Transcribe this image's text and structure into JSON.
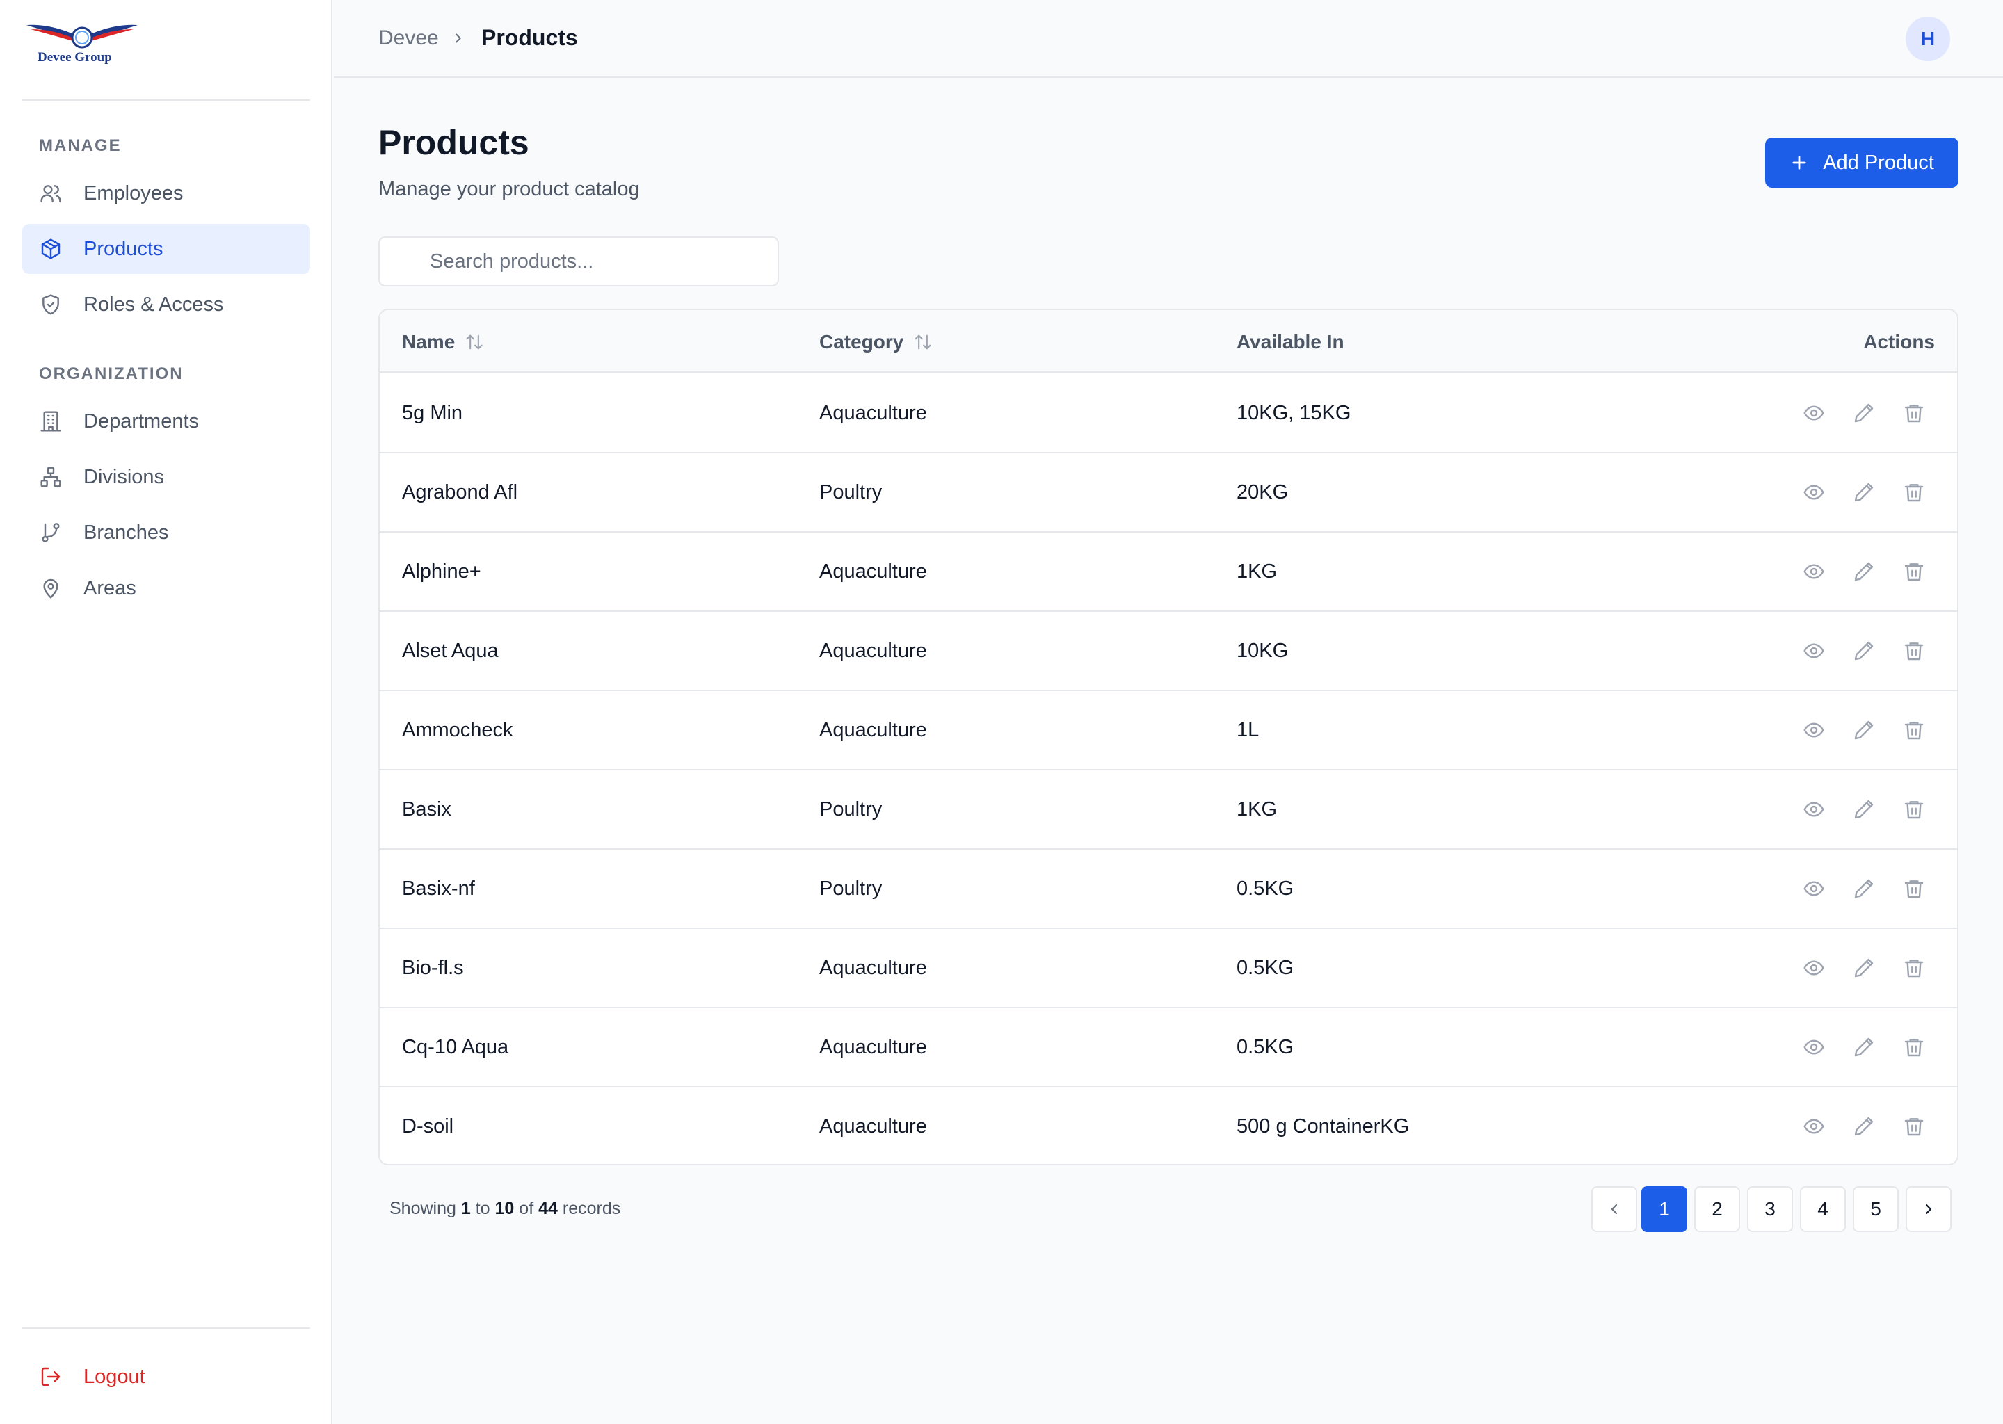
{
  "brand": {
    "logo_text": "Devee Group",
    "accent": "#1d5ee8"
  },
  "sidebar": {
    "sections": [
      {
        "label": "MANAGE",
        "items": [
          {
            "label": "Employees",
            "icon": "users-icon"
          },
          {
            "label": "Products",
            "icon": "box-icon",
            "active": true
          },
          {
            "label": "Roles & Access",
            "icon": "shield-icon"
          }
        ]
      },
      {
        "label": "ORGANIZATION",
        "items": [
          {
            "label": "Departments",
            "icon": "building-icon"
          },
          {
            "label": "Divisions",
            "icon": "network-icon"
          },
          {
            "label": "Branches",
            "icon": "git-branch-icon"
          },
          {
            "label": "Areas",
            "icon": "map-pin-icon"
          }
        ]
      }
    ],
    "logout_label": "Logout"
  },
  "header": {
    "breadcrumb_root": "Devee",
    "breadcrumb_current": "Products",
    "avatar_initial": "H"
  },
  "main": {
    "title": "Products",
    "subtitle": "Manage your product catalog",
    "add_button_label": "Add Product",
    "search_placeholder": "Search products...",
    "columns": [
      "Name",
      "Category",
      "Available In",
      "Actions"
    ],
    "rows": [
      {
        "name": "5g Min",
        "category": "Aquaculture",
        "available_in": "10KG, 15KG"
      },
      {
        "name": "Agrabond Afl",
        "category": "Poultry",
        "available_in": "20KG"
      },
      {
        "name": "Alphine+",
        "category": "Aquaculture",
        "available_in": "1KG"
      },
      {
        "name": "Alset Aqua",
        "category": "Aquaculture",
        "available_in": "10KG"
      },
      {
        "name": "Ammocheck",
        "category": "Aquaculture",
        "available_in": "1L"
      },
      {
        "name": "Basix",
        "category": "Poultry",
        "available_in": "1KG"
      },
      {
        "name": "Basix-nf",
        "category": "Poultry",
        "available_in": "0.5KG"
      },
      {
        "name": "Bio-fl.s",
        "category": "Aquaculture",
        "available_in": "0.5KG"
      },
      {
        "name": "Cq-10 Aqua",
        "category": "Aquaculture",
        "available_in": "0.5KG"
      },
      {
        "name": "D-soil",
        "category": "Aquaculture",
        "available_in": "500 g ContainerKG"
      }
    ],
    "row_actions": [
      "eye-icon",
      "pencil-icon",
      "trash-icon"
    ]
  },
  "pagination": {
    "showing_prefix": "Showing",
    "from": "1",
    "to_word": "to",
    "to": "10",
    "of_word": "of",
    "total": "44",
    "records_word": "records",
    "pages": [
      "1",
      "2",
      "3",
      "4",
      "5"
    ],
    "current_page": "1"
  }
}
